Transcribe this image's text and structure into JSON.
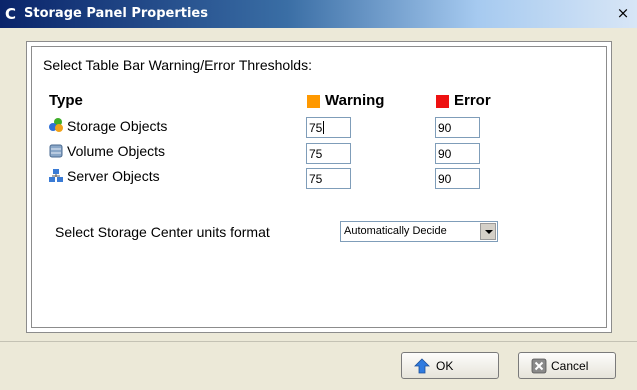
{
  "window": {
    "title": "Storage Panel Properties",
    "close_glyph": "×",
    "app_icon_glyph": "C"
  },
  "thresholds": {
    "instruction": "Select Table Bar Warning/Error Thresholds:",
    "headers": {
      "type": "Type",
      "warning": "Warning",
      "error": "Error"
    },
    "colors": {
      "warning": "#ff9900",
      "error": "#ee1111"
    },
    "rows": [
      {
        "label": "Storage Objects",
        "icon": "storage-objects-icon",
        "warning": "75",
        "error": "90"
      },
      {
        "label": "Volume Objects",
        "icon": "volume-objects-icon",
        "warning": "75",
        "error": "90"
      },
      {
        "label": "Server Objects",
        "icon": "server-objects-icon",
        "warning": "75",
        "error": "90"
      }
    ]
  },
  "units": {
    "label": "Select Storage Center units format",
    "selected": "Automatically Decide"
  },
  "buttons": {
    "ok": "OK",
    "cancel": "Cancel"
  }
}
